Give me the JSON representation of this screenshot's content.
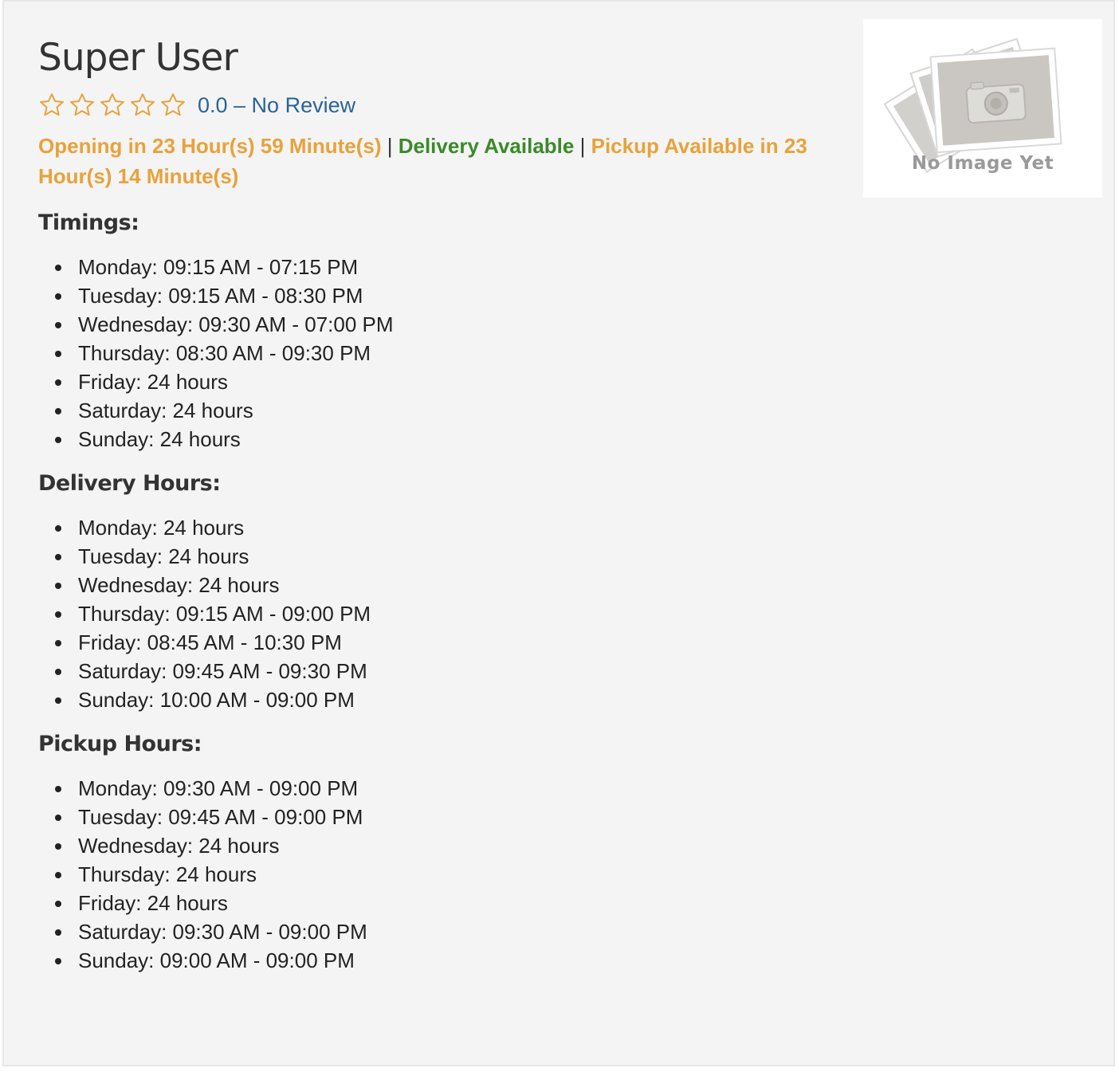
{
  "profile": {
    "name": "Super User",
    "rating": {
      "stars_total": 5,
      "stars_filled": 0,
      "star_color": "#e8a23b",
      "text": "0.0 – No Review"
    },
    "status": {
      "opening": "Opening in 23 Hour(s) 59 Minute(s)",
      "separator": "|",
      "delivery": "Delivery Available",
      "pickup": "Pickup Available in 23 Hour(s) 14 Minute(s)",
      "colors": {
        "opening": "#e8a23b",
        "delivery": "#3b8a2b",
        "pickup": "#e8a23b"
      }
    },
    "image": {
      "icon": "camera-photo-stack-placeholder-icon",
      "caption": "No Image Yet"
    }
  },
  "timings": {
    "title": "Timings:",
    "items": [
      "Monday: 09:15 AM - 07:15 PM",
      "Tuesday: 09:15 AM - 08:30 PM",
      "Wednesday: 09:30 AM - 07:00 PM",
      "Thursday: 08:30 AM - 09:30 PM",
      "Friday: 24 hours",
      "Saturday: 24 hours",
      "Sunday: 24 hours"
    ]
  },
  "delivery_hours": {
    "title": "Delivery Hours:",
    "items": [
      "Monday: 24 hours",
      "Tuesday: 24 hours",
      "Wednesday: 24 hours",
      "Thursday: 09:15 AM - 09:00 PM",
      "Friday: 08:45 AM - 10:30 PM",
      "Saturday: 09:45 AM - 09:30 PM",
      "Sunday: 10:00 AM - 09:00 PM"
    ]
  },
  "pickup_hours": {
    "title": "Pickup Hours:",
    "items": [
      "Monday: 09:30 AM - 09:00 PM",
      "Tuesday: 09:45 AM - 09:00 PM",
      "Wednesday: 24 hours",
      "Thursday: 24 hours",
      "Friday: 24 hours",
      "Saturday: 09:30 AM - 09:00 PM",
      "Sunday: 09:00 AM - 09:00 PM"
    ]
  }
}
